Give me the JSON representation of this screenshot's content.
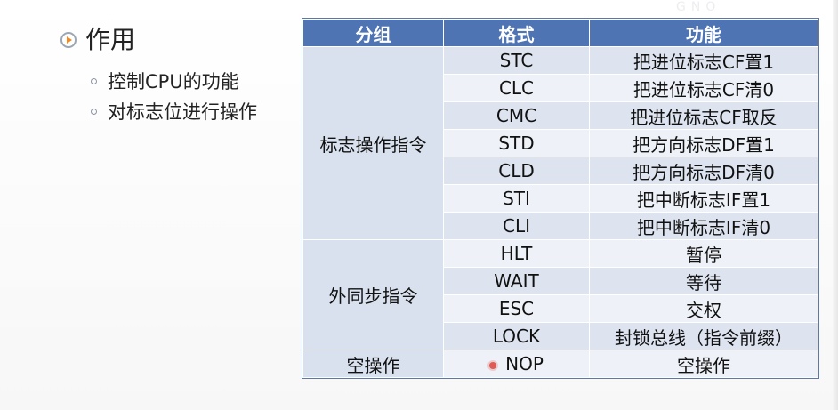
{
  "slide": {
    "watermark": "GNO",
    "heading": "作用",
    "bullets": [
      "控制CPU的功能",
      "对标志位进行操作"
    ]
  },
  "table": {
    "headers": {
      "group": "分组",
      "format": "格式",
      "function": "功能"
    },
    "groups": [
      {
        "name": "标志操作指令",
        "rows": [
          {
            "format": "STC",
            "function": "把进位标志CF置1"
          },
          {
            "format": "CLC",
            "function": "把进位标志CF清0"
          },
          {
            "format": "CMC",
            "function": "把进位标志CF取反"
          },
          {
            "format": "STD",
            "function": "把方向标志DF置1"
          },
          {
            "format": "CLD",
            "function": "把方向标志DF清0"
          },
          {
            "format": "STI",
            "function": "把中断标志IF置1"
          },
          {
            "format": "CLI",
            "function": "把中断标志IF清0"
          }
        ]
      },
      {
        "name": "外同步指令",
        "rows": [
          {
            "format": "HLT",
            "function": "暂停"
          },
          {
            "format": "WAIT",
            "function": "等待"
          },
          {
            "format": "ESC",
            "function": "交权"
          },
          {
            "format": "LOCK",
            "function": "封锁总线（指令前缀）"
          }
        ]
      },
      {
        "name": "空操作",
        "rows": [
          {
            "format": "NOP",
            "function": "空操作"
          }
        ]
      }
    ]
  },
  "colors": {
    "header_bg": "#4f74b3",
    "row_dark": "#dde4f0",
    "row_light": "#eef2f8",
    "bullet_accent": "#f08a24",
    "cursor_marker": "#e05a57"
  }
}
